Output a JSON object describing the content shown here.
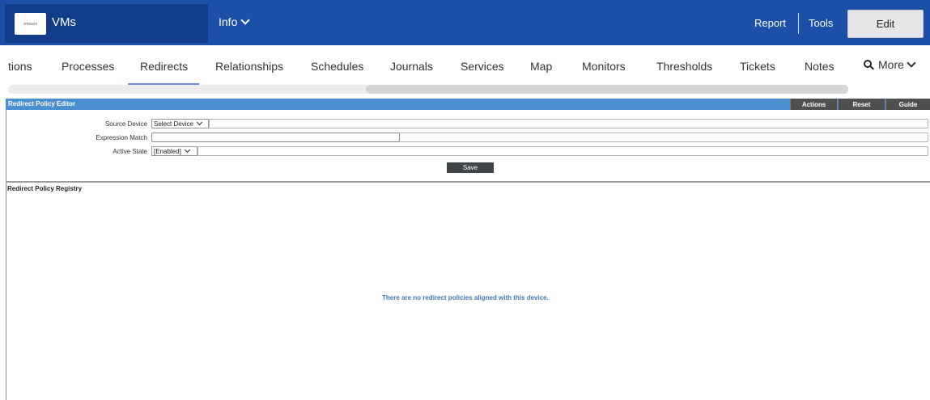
{
  "topbar": {
    "logo_text": "vmware",
    "app_title": "VMs",
    "info_menu": "Info",
    "report": "Report",
    "tools": "Tools",
    "edit": "Edit",
    "colors": {
      "bar": "#1b4fa8",
      "left_panel": "#123d8a"
    }
  },
  "tabs": {
    "items": [
      "tions",
      "Processes",
      "Redirects",
      "Relationships",
      "Schedules",
      "Journals",
      "Services",
      "Map",
      "Monitors",
      "Thresholds",
      "Tickets",
      "Notes"
    ],
    "active": "Redirects",
    "more": "More"
  },
  "editor": {
    "title": "Redirect Policy Editor",
    "header_buttons": [
      "Actions",
      "Reset",
      "Guide"
    ],
    "source_device_label": "Source Device",
    "source_device_value": "Select Device",
    "expression_match_label": "Expression Match",
    "active_state_label": "Active State",
    "active_state_value": "[Enabled]",
    "save": "Save",
    "header_color": "#4a8fcf"
  },
  "registry": {
    "title": "Redirect Policy Registry",
    "empty_message": "There are no redirect policies aligned with this device."
  }
}
